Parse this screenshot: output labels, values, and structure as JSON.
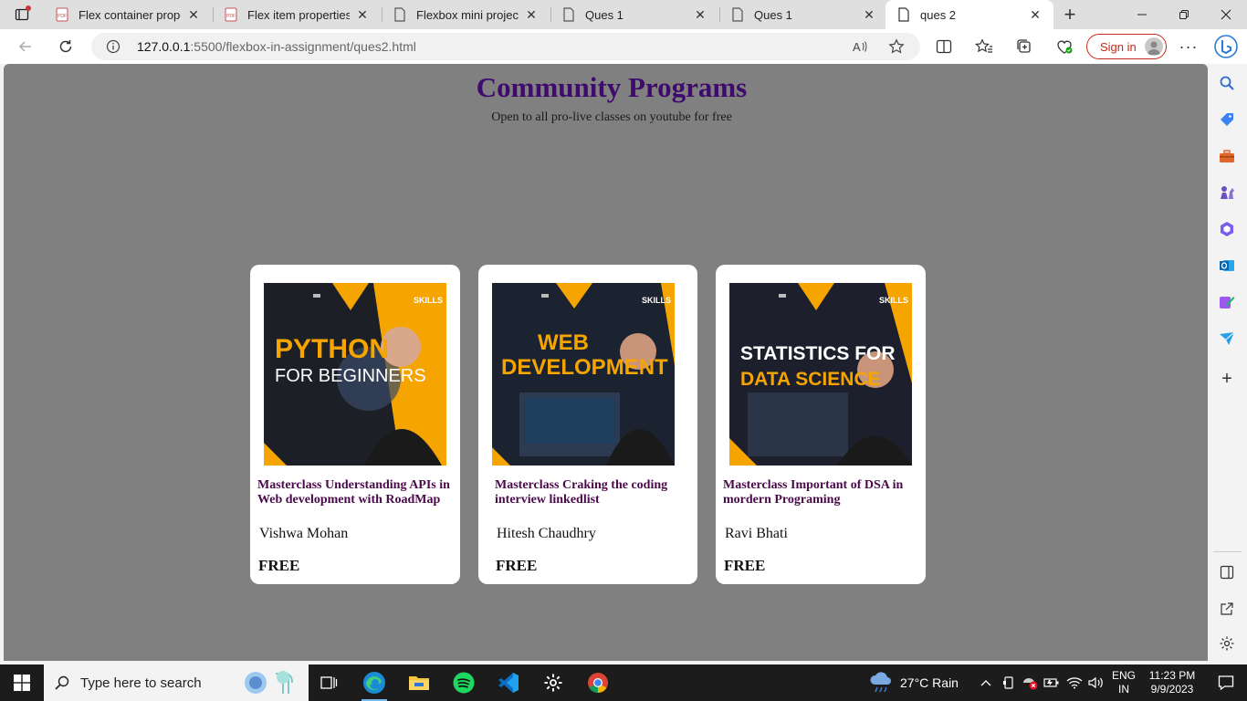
{
  "browser": {
    "tabs": [
      {
        "title": "Flex container properti",
        "icon": "pdf-icon"
      },
      {
        "title": "Flex item properties.pc",
        "icon": "pdf-icon"
      },
      {
        "title": "Flexbox mini project",
        "icon": "page-icon"
      },
      {
        "title": "Ques 1",
        "icon": "page-icon"
      },
      {
        "title": "Ques 1",
        "icon": "page-icon"
      },
      {
        "title": "ques 2",
        "icon": "page-icon",
        "active": true
      }
    ],
    "url_host": "127.0.0.1",
    "url_rest": ":5500/flexbox-in-assignment/ques2.html",
    "signin_label": "Sign in"
  },
  "page": {
    "title": "Community Programs",
    "subtitle": "Open to all pro-live classes on youtube for free",
    "cards": [
      {
        "thumb_line1": "PYTHON",
        "thumb_line2": "FOR BEGINNERS",
        "brand": "SKILLS",
        "title": "Masterclass Understanding APIs in Web development with RoadMap",
        "author": "Vishwa Mohan",
        "price": "FREE"
      },
      {
        "thumb_line1": "WEB",
        "thumb_line2": "DEVELOPMENT",
        "brand": "SKILLS",
        "title": "Masterclass Craking the coding interview linkedlist",
        "author": "Hitesh Chaudhry",
        "price": "FREE"
      },
      {
        "thumb_line1": "STATISTICS FOR",
        "thumb_line2": "DATA SCIENCE",
        "brand": "SKILLS",
        "title": "Masterclass Important of DSA in mordern Programing",
        "author": "Ravi Bhati",
        "price": "FREE"
      }
    ]
  },
  "taskbar": {
    "search_placeholder": "Type here to search",
    "weather": "27°C  Rain",
    "lang_line1": "ENG",
    "lang_line2": "IN",
    "time": "11:23 PM",
    "date": "9/9/2023"
  },
  "colors": {
    "page_bg": "#808080",
    "title": "#3f0a6e",
    "card_title": "#4a0a4a",
    "thumb_yellow": "#f6a500",
    "signin_red": "#c42b1c"
  }
}
